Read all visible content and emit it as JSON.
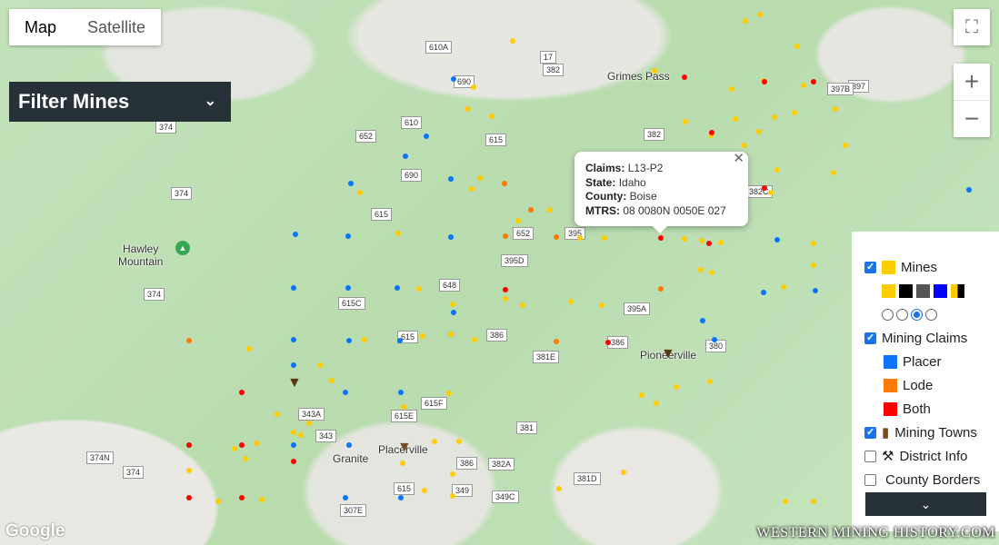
{
  "map_type": {
    "options": [
      "Map",
      "Satellite"
    ],
    "selected": "Map"
  },
  "filter": {
    "title": "Filter Mines",
    "chevron": "chevron-down-icon"
  },
  "places": [
    "Grimes Pass",
    "Hawley\nMountain",
    "Pioneerville",
    "Granite",
    "Placerville"
  ],
  "roads": [
    "610A",
    "17",
    "382",
    "690",
    "610",
    "652",
    "615",
    "690",
    "374",
    "374",
    "382",
    "397",
    "397B",
    "382C",
    "615",
    "395",
    "652",
    "395D",
    "648",
    "615C",
    "374",
    "395A",
    "386",
    "615",
    "386",
    "381E",
    "380",
    "343A",
    "615F",
    "615E",
    "343",
    "381",
    "374N",
    "374",
    "386",
    "382A",
    "381D",
    "615",
    "349",
    "349C",
    "307E"
  ],
  "popup": {
    "claims_label": "Claims:",
    "claims": "L13-P2",
    "state_label": "State:",
    "state": "Idaho",
    "county_label": "County:",
    "county": "Boise",
    "mtrs_label": "MTRS:",
    "mtrs": "08 0080N 0050E 027"
  },
  "legend": {
    "mines": {
      "label": "Mines",
      "checked": true,
      "color": "#ffcc00",
      "color_options": [
        "#ffcc00",
        "#000000",
        "#555555",
        "#0000ff",
        "#ffcc00/#000000"
      ],
      "selected_option": 2
    },
    "claims": {
      "label": "Mining Claims",
      "checked": true,
      "types": [
        {
          "label": "Placer",
          "color": "#0a74ff"
        },
        {
          "label": "Lode",
          "color": "#ff7a00"
        },
        {
          "label": "Both",
          "color": "#ff0000"
        }
      ]
    },
    "towns": {
      "label": "Mining Towns",
      "checked": true
    },
    "district": {
      "label": "District Info",
      "checked": false,
      "icon": "⚒"
    },
    "county": {
      "label": "County Borders",
      "checked": false
    },
    "more": "chevron-down-icon"
  },
  "controls": {
    "zoom_in": "+",
    "zoom_out": "−",
    "fullscreen": "fullscreen-icon"
  },
  "attribution": {
    "google": "Google",
    "watermark": "Western Mining History.com"
  }
}
